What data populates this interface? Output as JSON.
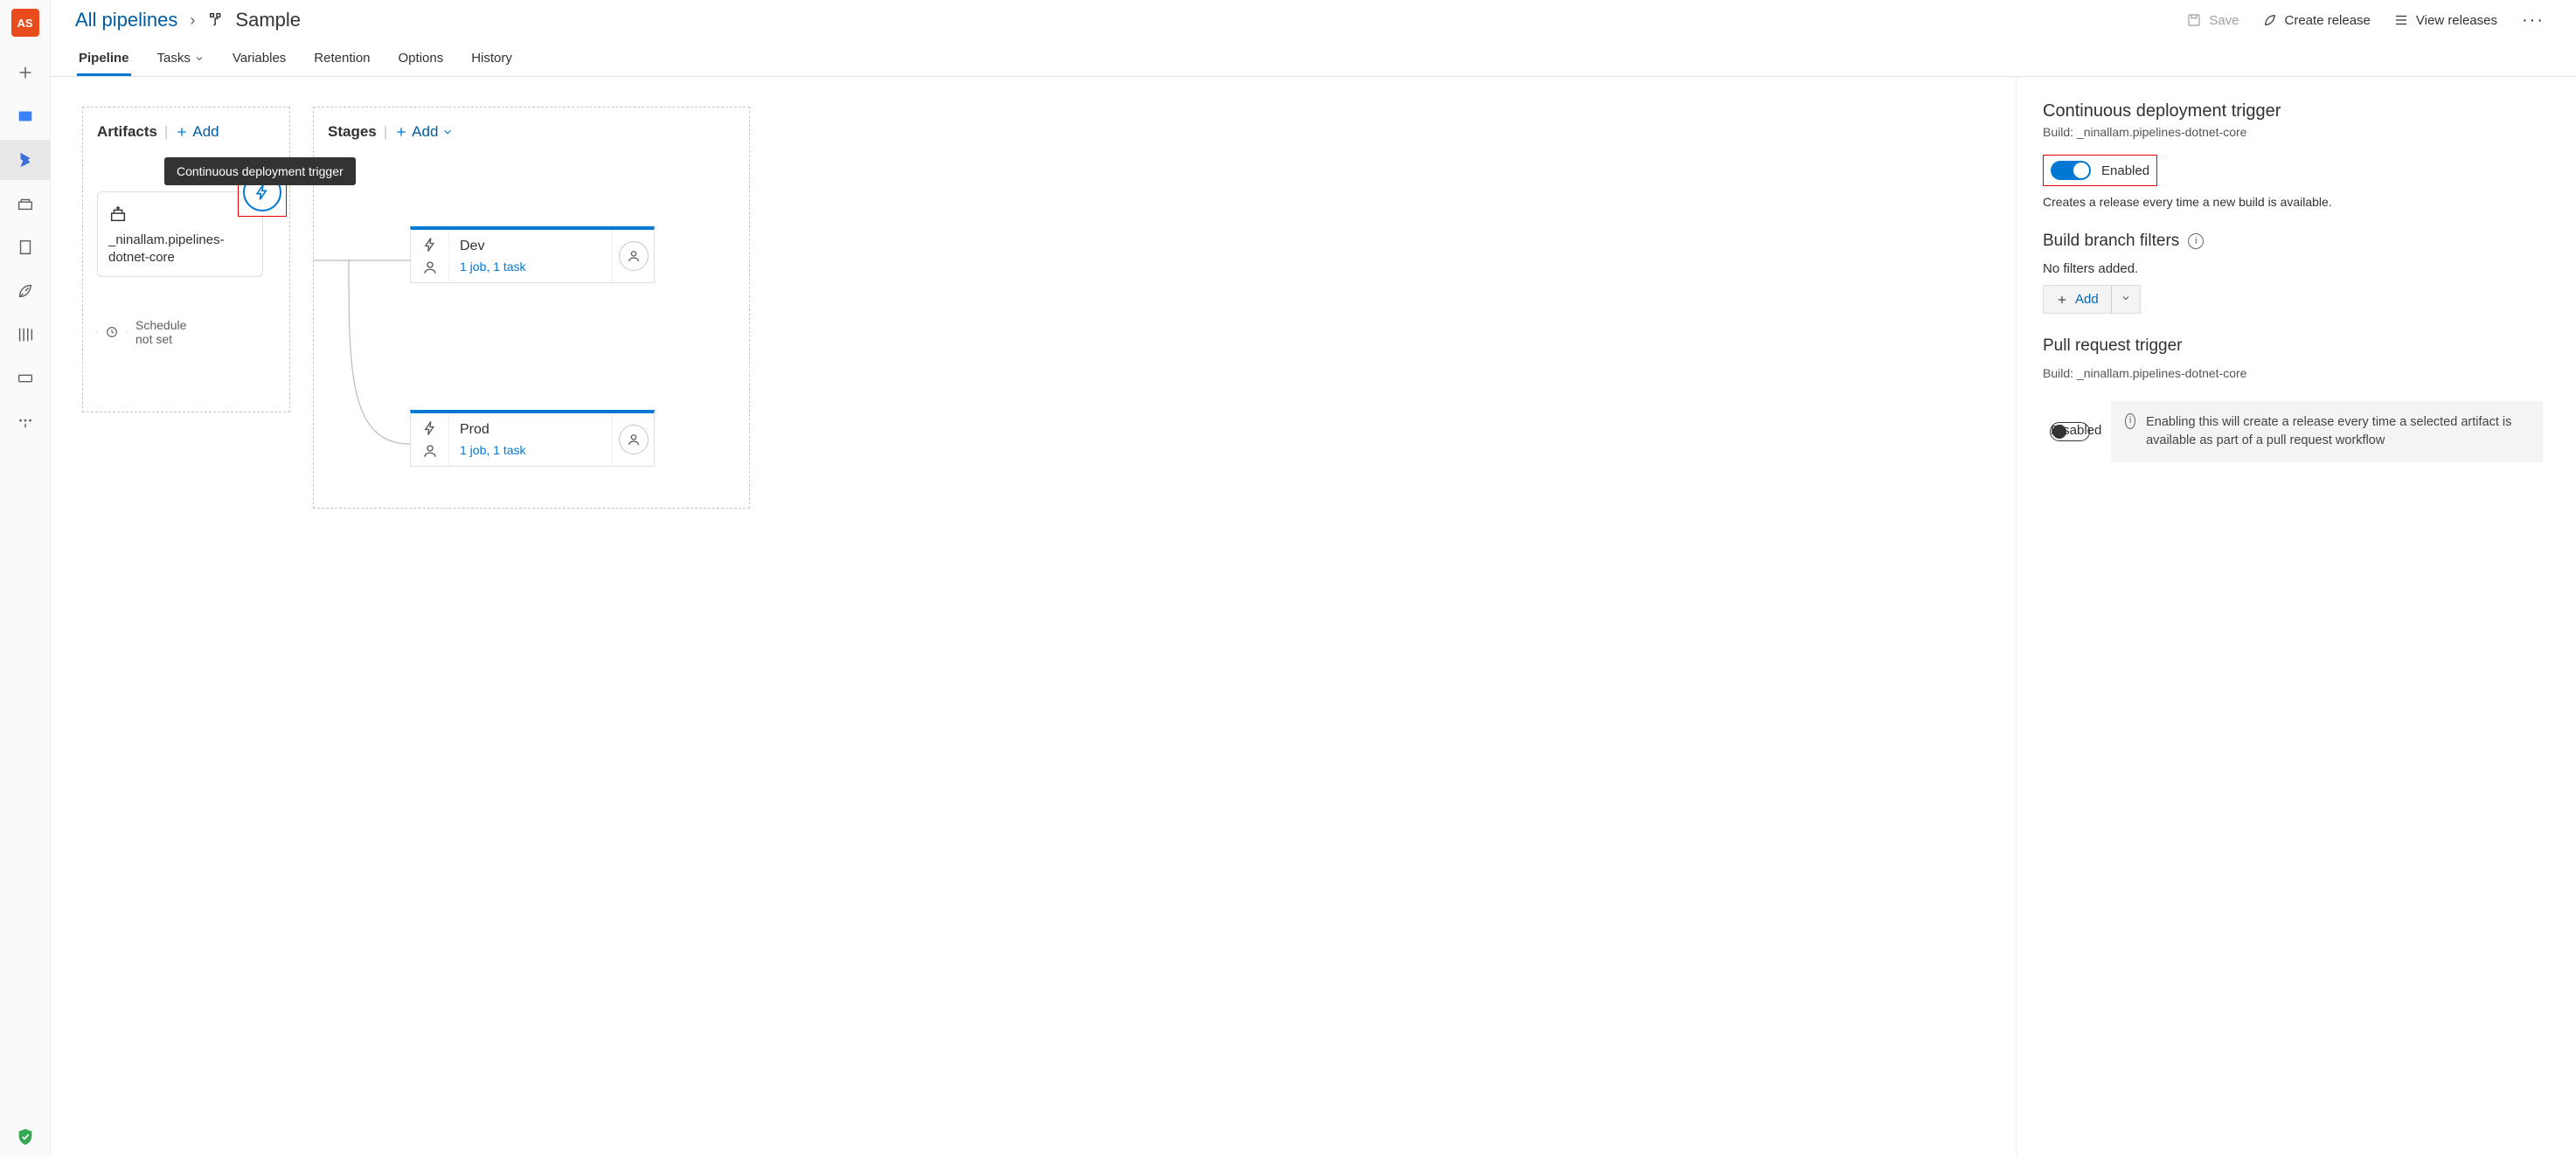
{
  "leftNav": {
    "badge": "AS"
  },
  "breadcrumb": {
    "root": "All pipelines",
    "name": "Sample"
  },
  "commands": {
    "save": "Save",
    "createRelease": "Create release",
    "viewReleases": "View releases"
  },
  "tabs": {
    "pipeline": "Pipeline",
    "tasks": "Tasks",
    "variables": "Variables",
    "retention": "Retention",
    "options": "Options",
    "history": "History"
  },
  "artifacts": {
    "title": "Artifacts",
    "add": "Add",
    "tooltip": "Continuous deployment trigger",
    "artifactName": "_ninallam.pipelines-dotnet-core",
    "scheduleLabel": "Schedule",
    "scheduleValue": "not set"
  },
  "stages": {
    "title": "Stages",
    "add": "Add",
    "items": [
      {
        "name": "Dev",
        "sub": "1 job, 1 task"
      },
      {
        "name": "Prod",
        "sub": "1 job, 1 task"
      }
    ]
  },
  "panel": {
    "cd": {
      "title": "Continuous deployment trigger",
      "build": "Build: _ninallam.pipelines-dotnet-core",
      "toggleLabel": "Enabled",
      "desc": "Creates a release every time a new build is available."
    },
    "filters": {
      "title": "Build branch filters",
      "none": "No filters added.",
      "add": "Add"
    },
    "pr": {
      "title": "Pull request trigger",
      "build": "Build: _ninallam.pipelines-dotnet-core",
      "toggleLabel": "Disabled",
      "info": "Enabling this will create a release every time a selected artifact is available as part of a pull request workflow"
    }
  }
}
